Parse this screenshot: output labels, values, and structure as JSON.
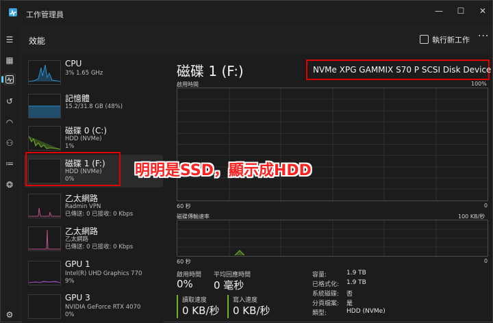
{
  "window": {
    "title": "工作管理員",
    "minimize": "—",
    "maximize": "☐",
    "close": "✕"
  },
  "header": {
    "title": "效能",
    "run_task": "執行新工作",
    "more": "···"
  },
  "rail": {
    "icons": [
      "hamburger-icon",
      "processes-icon",
      "performance-icon",
      "history-icon",
      "startup-icon",
      "users-icon",
      "details-icon",
      "services-icon",
      "settings-icon"
    ]
  },
  "list": [
    {
      "name": "CPU",
      "sub1": "3%  1.65 GHz",
      "sub2": "",
      "color": "#2a8fcf"
    },
    {
      "name": "記憶體",
      "sub1": "15.2/31.8 GB (48%)",
      "sub2": "",
      "color": "#2a8fcf"
    },
    {
      "name": "磁碟 0 (C:)",
      "sub1": "HDD (NVMe)",
      "sub2": "1%",
      "color": "#6fb32a"
    },
    {
      "name": "磁碟 1 (F:)",
      "sub1": "HDD (NVMe)",
      "sub2": "0%",
      "color": "#6fb32a"
    },
    {
      "name": "乙太網路",
      "sub1": "Radmin VPN",
      "sub2": "已傳送: 0  已接收: 0 Kbps",
      "color": "#c0508a"
    },
    {
      "name": "乙太網路",
      "sub1": "乙太網路",
      "sub2": "已傳送: 0  已接收: 0 Kbps",
      "color": "#c0508a"
    },
    {
      "name": "GPU 1",
      "sub1": "Intel(R) UHD Graphics 770",
      "sub2": "9%",
      "color": "#9a4fbf"
    },
    {
      "name": "GPU 3",
      "sub1": "NVIDIA GeForce RTX 4070",
      "sub2": "0%",
      "color": "#9a4fbf"
    }
  ],
  "main": {
    "disk_title": "磁碟 1 (F:)",
    "model": "NVMe XPG GAMMIX S70 P SCSI Disk Device",
    "graph1": {
      "label": "啟用時間",
      "max": "100%",
      "time": "60 秒",
      "zero": "0"
    },
    "graph2": {
      "label": "磁碟傳輸速率",
      "max": "100 KB/秒",
      "time": "60 秒",
      "zero": "0"
    },
    "stats": {
      "active_label": "啟用時間",
      "active_value": "0%",
      "resp_label": "平均回應時間",
      "resp_value": "0 毫秒",
      "read_label": "讀取速度",
      "read_value": "0 KB/秒",
      "write_label": "寫入速度",
      "write_value": "0 KB/秒"
    },
    "props": [
      {
        "k": "容量:",
        "v": "1.9 TB"
      },
      {
        "k": "已格式化:",
        "v": "1.9 TB"
      },
      {
        "k": "系統磁碟:",
        "v": "否"
      },
      {
        "k": "分頁檔案:",
        "v": "是"
      },
      {
        "k": "類型:",
        "v": "HDD (NVMe)"
      }
    ]
  },
  "annotation": "明明是SSD，顯示成HDD",
  "colors": {
    "highlight": "#e00000",
    "accent": "#60cdff",
    "disk_green": "#6fb32a"
  }
}
